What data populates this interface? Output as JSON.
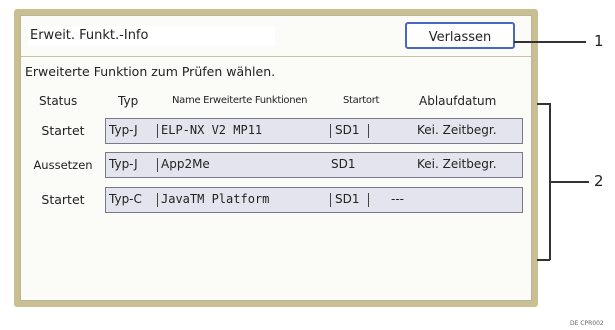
{
  "window": {
    "title": "Erweit. Funkt.-Info",
    "exit_label": "Verlassen",
    "instruction": "Erweiterte Funktion zum Prüfen wählen."
  },
  "table": {
    "headers": {
      "status": "Status",
      "type": "Typ",
      "name": "Name Erweiterte Funktionen",
      "location": "Startort",
      "expiry": "Ablaufdatum"
    },
    "rows": [
      {
        "status": "Startet",
        "type": "Typ-J",
        "name": "ELP-NX V2 MP11",
        "location": "SD1",
        "expiry": "Kei. Zeitbegr."
      },
      {
        "status": "Aussetzen",
        "type": "Typ-J",
        "name": "App2Me",
        "location": "SD1",
        "expiry": "Kei. Zeitbegr."
      },
      {
        "status": "Startet",
        "type": "Typ-C",
        "name": "JavaTM Platform",
        "location": "SD1",
        "expiry": "---"
      }
    ]
  },
  "callouts": {
    "one": "1",
    "two": "2"
  },
  "credit": "DE CPR002"
}
